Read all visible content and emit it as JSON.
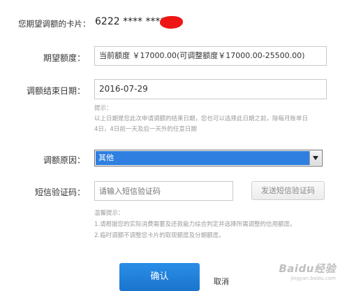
{
  "card": {
    "label": "您期望调额的卡片：",
    "number": "6222 **** ****"
  },
  "expected_limit": {
    "label": "期望额度：",
    "value": "当前额度 ￥17000.00(可调整额度￥17000.00-25500.00)"
  },
  "end_date": {
    "label": "调额结束日期：",
    "value": "2016-07-29",
    "hint_title": "提示：",
    "hint_line1": "以上日期是您此次申请调额的结束日期，您也可以选择此日期之前，除每月账单日",
    "hint_line2": "4日，4日前一天及后一天外的任意日期"
  },
  "reason": {
    "label": "调额原因：",
    "selected": "其他",
    "icon": "chevron-down-icon"
  },
  "sms": {
    "label": "短信验证码：",
    "placeholder": "请输入短信验证码",
    "send_button": "发送短信验证码"
  },
  "tips": {
    "title": "温馨提示：",
    "line1": "1.请根据您的实际消费需要及还款能力综合判定并选择所需调整的信用额度。",
    "line2": "2.临时调额不调整您卡片的取现额度及分期额度。"
  },
  "actions": {
    "confirm": "确认",
    "cancel": "取消"
  },
  "watermark": {
    "text": "Baidu经验",
    "sub": "jingyan.baidu.com"
  },
  "colors": {
    "accent": "#1b7fd8",
    "redaction": "#ee1515",
    "select_highlight": "#2f7fe0"
  }
}
